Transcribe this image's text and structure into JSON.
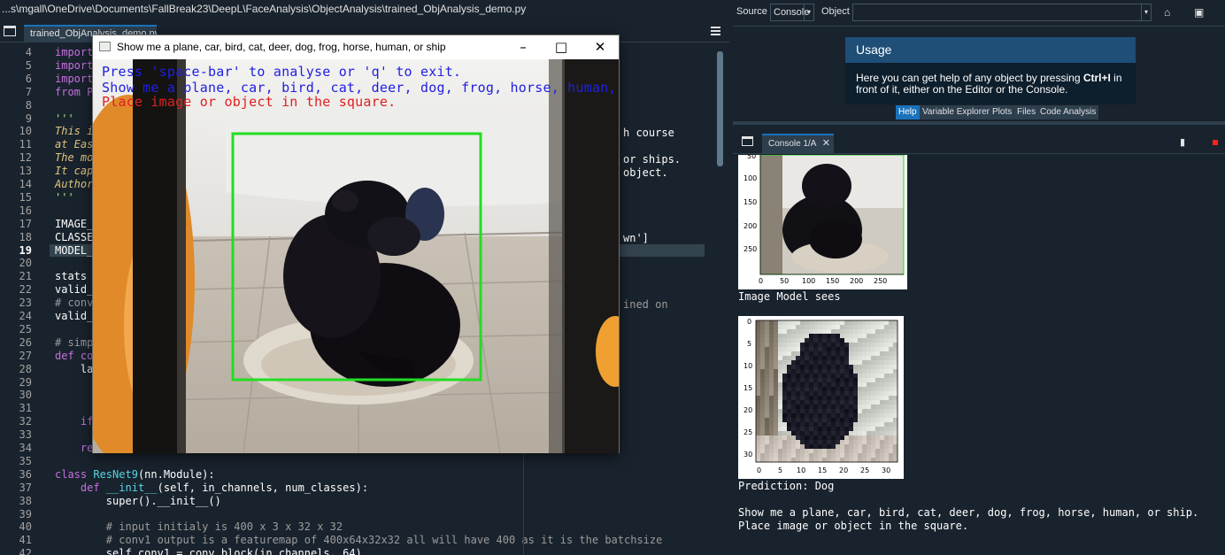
{
  "editor": {
    "path": "...s\\mgall\\OneDrive\\Documents\\FallBreak23\\DeepL\\FaceAnalysis\\ObjectAnalysis\\trained_ObjAnalysis_demo.py",
    "tab_label": "trained_ObjAnalysis_demo.py",
    "lines": [
      {
        "n": "4",
        "t": "import"
      },
      {
        "n": "5",
        "t": "import"
      },
      {
        "n": "6",
        "t": "import"
      },
      {
        "n": "7",
        "t": "from Pl"
      },
      {
        "n": "8",
        "t": ""
      },
      {
        "n": "9",
        "t": "'''"
      },
      {
        "n": "10",
        "t": "This i"
      },
      {
        "n": "11",
        "t": "at Eas"
      },
      {
        "n": "12",
        "t": "The mo"
      },
      {
        "n": "13",
        "t": "It cap"
      },
      {
        "n": "14",
        "t": "Author"
      },
      {
        "n": "15",
        "t": "'''"
      },
      {
        "n": "16",
        "t": ""
      },
      {
        "n": "17",
        "t": "IMAGE_"
      },
      {
        "n": "18",
        "t": "CLASSE"
      },
      {
        "n": "19",
        "t": "MODEL_"
      },
      {
        "n": "20",
        "t": ""
      },
      {
        "n": "21",
        "t": "stats "
      },
      {
        "n": "22",
        "t": "valid_"
      },
      {
        "n": "23",
        "t": "# conv"
      },
      {
        "n": "24",
        "t": "valid_"
      },
      {
        "n": "25",
        "t": ""
      },
      {
        "n": "26",
        "t": "# simp"
      },
      {
        "n": "27",
        "t": "def co"
      },
      {
        "n": "28",
        "t": "    lay"
      },
      {
        "n": "29",
        "t": ""
      },
      {
        "n": "30",
        "t": ""
      },
      {
        "n": "31",
        "t": ""
      },
      {
        "n": "32",
        "t": "    if"
      },
      {
        "n": "33",
        "t": ""
      },
      {
        "n": "34",
        "t": "    ret"
      },
      {
        "n": "35",
        "t": ""
      },
      {
        "n": "36",
        "t": "class ResNet9(nn.Module):"
      },
      {
        "n": "37",
        "t": "    def __init__(self, in_channels, num_classes):"
      },
      {
        "n": "38",
        "t": "        super().__init__()"
      },
      {
        "n": "39",
        "t": ""
      },
      {
        "n": "40",
        "t": "        # input initialy is 400 x 3 x 32 x 32"
      },
      {
        "n": "41",
        "t": "        # conv1 output is a featuremap of 400x64x32x32 all will have 400 as it is the batchsize"
      },
      {
        "n": "42",
        "t": "        self.conv1 = conv_block(in_channels, 64)"
      }
    ],
    "right_fragments": {
      "l10": "h course",
      "l12": "or ships.",
      "l13": "object.",
      "l18": "wn']",
      "l23": "ined on"
    },
    "current_line": "19"
  },
  "camera": {
    "title": "Show me a plane, car, bird, cat, deer, dog, frog, horse, human, or ship",
    "line1": "Press 'space-bar' to analyse or 'q' to exit.",
    "line2": "Show me a plane, car, bird, cat, deer, dog, frog, horse, human, or ship.",
    "line3": "Place image or object in the square.",
    "colors": {
      "line1": "#2020e0",
      "line2": "#2020e0",
      "line3": "#e02020",
      "box": "#22dd22"
    }
  },
  "help": {
    "source_label": "Source",
    "source_value": "Console",
    "object_label": "Object",
    "usage_title": "Usage",
    "usage_pre": "Here you can get help of any object by pressing ",
    "usage_key": "Ctrl+I",
    "usage_post": " in front of it, either on the Editor or the Console.",
    "tabs": [
      "Help",
      "Variable Explorer",
      "Plots",
      "Files",
      "Code Analysis"
    ]
  },
  "console": {
    "tab_label": "Console 1/A",
    "plot1_yticks": [
      "50",
      "100",
      "150",
      "200",
      "250"
    ],
    "plot1_xticks": [
      "0",
      "50",
      "100",
      "150",
      "200",
      "250"
    ],
    "caption1": "Image Model sees",
    "plot2_yticks": [
      "0",
      "5",
      "10",
      "15",
      "20",
      "25",
      "30"
    ],
    "plot2_xticks": [
      "0",
      "5",
      "10",
      "15",
      "20",
      "25",
      "30"
    ],
    "prediction": "Prediction: Dog",
    "prompt1": "Show me a plane, car, bird, cat, deer, dog, frog, horse, human, or ship.",
    "prompt2": "Place image or object in the square."
  }
}
